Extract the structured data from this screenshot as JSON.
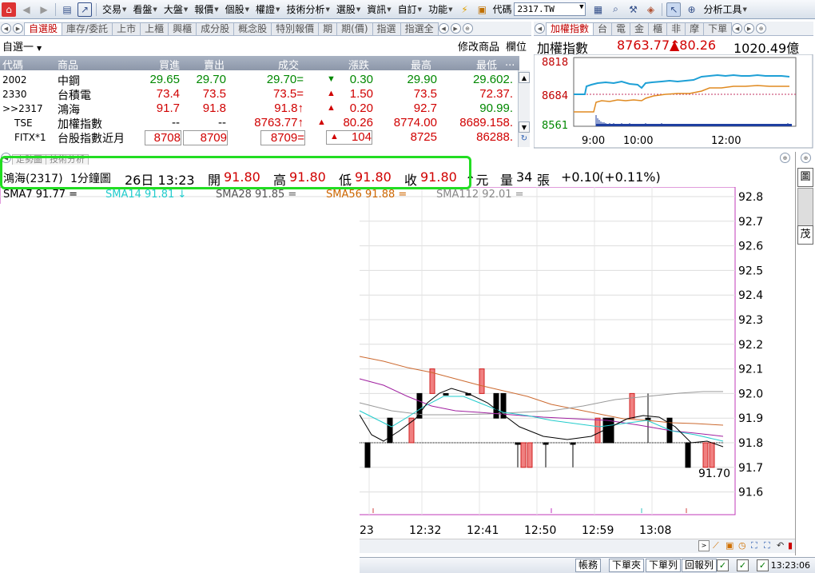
{
  "toolbar": {
    "menus": [
      "交易",
      "看盤",
      "大盤",
      "報價",
      "個股",
      "權證",
      "技術分析",
      "選股",
      "資訊",
      "自訂",
      "功能"
    ],
    "code_label": "代碼",
    "code_value": "2317.TW",
    "analysis_tools": "分析工具"
  },
  "watchlist": {
    "tabs": [
      "自選股",
      "庫存/委託",
      "上市",
      "上櫃",
      "興櫃",
      "成分股",
      "概念股",
      "特別報價",
      "期",
      "期(價)",
      "指選",
      "指選全"
    ],
    "group": "自選一",
    "modify": "修改商品",
    "column": "欄位",
    "headers": [
      "代碼",
      "商品",
      "買進",
      "賣出",
      "成交",
      "漲跌",
      "最高",
      "最低",
      "..."
    ],
    "rows": [
      {
        "code": "2002",
        "name": "中鋼",
        "bid": "29.65",
        "ask": "29.70",
        "last": "29.70=",
        "chg_sym": "▼",
        "chg": "0.30",
        "high": "29.90",
        "low": "29.602.",
        "color": "green"
      },
      {
        "code": "2330",
        "name": "台積電",
        "bid": "73.4",
        "ask": "73.5",
        "last": "73.5=",
        "chg_sym": "▲",
        "chg": "1.50",
        "high": "73.5",
        "low": "72.37.",
        "color": "red"
      },
      {
        "code": ">>2317",
        "name": "鴻海",
        "bid": "91.7",
        "ask": "91.8",
        "last": "91.8↑",
        "chg_sym": "▲",
        "chg": "0.20",
        "high": "92.7",
        "low": "90.99.",
        "color": "red"
      },
      {
        "code": "TSE",
        "name": "加權指數",
        "bid": "--",
        "ask": "--",
        "last": "8763.77↑",
        "chg_sym": "▲",
        "chg": "80.26",
        "high": "8774.00",
        "low": "8689.158.",
        "color": "red"
      },
      {
        "code": "FITX*1",
        "name": "台股指數近月",
        "bid": "8708",
        "ask": "8709",
        "last": "8709=",
        "chg_sym": "▲",
        "chg": "104",
        "high": "8725",
        "low": "86288.",
        "color": "red"
      }
    ]
  },
  "index": {
    "tabs": [
      "加權指數",
      "台",
      "電",
      "金",
      "櫃",
      "非",
      "摩",
      "下單"
    ],
    "name": "加權指數",
    "value": "8763.77↑",
    "change": "▲80.26",
    "volume": "1020.49億",
    "y_labels": [
      "8818",
      "8684",
      "8561"
    ],
    "x_labels": [
      "9:00",
      "10:00",
      "12:00"
    ]
  },
  "chart": {
    "tabs": [
      "走勢圖",
      "技術分析"
    ],
    "info": {
      "stock": "鴻海(2317)",
      "period": "1分鐘圖",
      "datetime": "26日 13:23",
      "open_label": "開",
      "open": "91.80",
      "high_label": "高",
      "high": "91.80",
      "low_label": "低",
      "low": "91.80",
      "close_label": "收",
      "close": "91.80",
      "unit": "↑元",
      "vol_label": "量",
      "vol": "34",
      "vol_unit": "張",
      "change": "+0.10",
      "change_pct": "(+0.11%)"
    },
    "sma": [
      {
        "label": "SMA7 91.77 =",
        "color": "#000000"
      },
      {
        "label": "SMA14 91.81 ↓",
        "color": "#22cccc"
      },
      {
        "label": "SMA28 91.85 =",
        "color": "#555555"
      },
      {
        "label": "SMA56 91.88 =",
        "color": "#cc6600"
      },
      {
        "label": "SMA112 92.01 =",
        "color": "#888888"
      }
    ],
    "y_labels": [
      "92.8",
      "92.7",
      "92.6",
      "92.5",
      "92.4",
      "92.3",
      "92.2",
      "92.1",
      "92.0",
      "91.9",
      "91.8",
      "91.7",
      "91.6"
    ],
    "x_labels": [
      "23",
      "12:32",
      "12:41",
      "12:50",
      "12:59",
      "13:08"
    ],
    "last_label": "91.70"
  },
  "side": {
    "tab1": "圖",
    "tab2": "茂"
  },
  "status": {
    "buttons": [
      "帳務",
      "下單夾",
      "下單列",
      "回報列"
    ],
    "time": "13:23:06"
  }
}
